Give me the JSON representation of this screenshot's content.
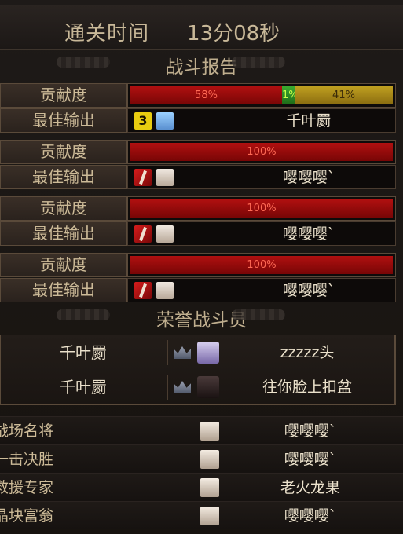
{
  "header": {
    "clear_time_label": "通关时间",
    "clear_time_value": "13分08秒"
  },
  "battle_report": {
    "title": "战斗报告",
    "contribution_label": "贡献度",
    "best_output_label": "最佳输出",
    "players": [
      {
        "bars": [
          {
            "label": "58%",
            "value": 58,
            "color": "#a00e0e"
          },
          {
            "label": "1%",
            "value": 1,
            "color": "#30a030"
          },
          {
            "label": "41%",
            "value": 41,
            "color": "#b09018"
          }
        ],
        "job_icon": "three-icon",
        "job_icon_text": "3",
        "avatar": "blue-avatar-icon",
        "best_output_name": "千叶罽"
      },
      {
        "bars": [
          {
            "label": "100%",
            "value": 100,
            "color": "#a00e0e"
          }
        ],
        "job_icon": "slash-icon",
        "avatar": "white-avatar-icon",
        "best_output_name": "嘤嘤嘤`"
      },
      {
        "bars": [
          {
            "label": "100%",
            "value": 100,
            "color": "#a00e0e"
          }
        ],
        "job_icon": "slash-icon",
        "avatar": "white-avatar-icon",
        "best_output_name": "嘤嘤嘤`"
      },
      {
        "bars": [
          {
            "label": "100%",
            "value": 100,
            "color": "#a00e0e"
          }
        ],
        "job_icon": "slash-icon",
        "avatar": "white-avatar-icon",
        "best_output_name": "嘤嘤嘤`"
      }
    ]
  },
  "honor": {
    "title": "荣誉战斗员",
    "rows": [
      {
        "left_name": "千叶罽",
        "right_name": "zzzzz头"
      },
      {
        "left_name": "千叶罽",
        "right_name": "往你脸上扣盆"
      }
    ]
  },
  "titles": [
    {
      "title": "战场名将",
      "player": "嘤嘤嘤`"
    },
    {
      "title": "一击决胜",
      "player": "嘤嘤嘤`"
    },
    {
      "title": "救援专家",
      "player": "老火龙果"
    },
    {
      "title": "晶块富翁",
      "player": "嘤嘤嘤`"
    }
  ]
}
